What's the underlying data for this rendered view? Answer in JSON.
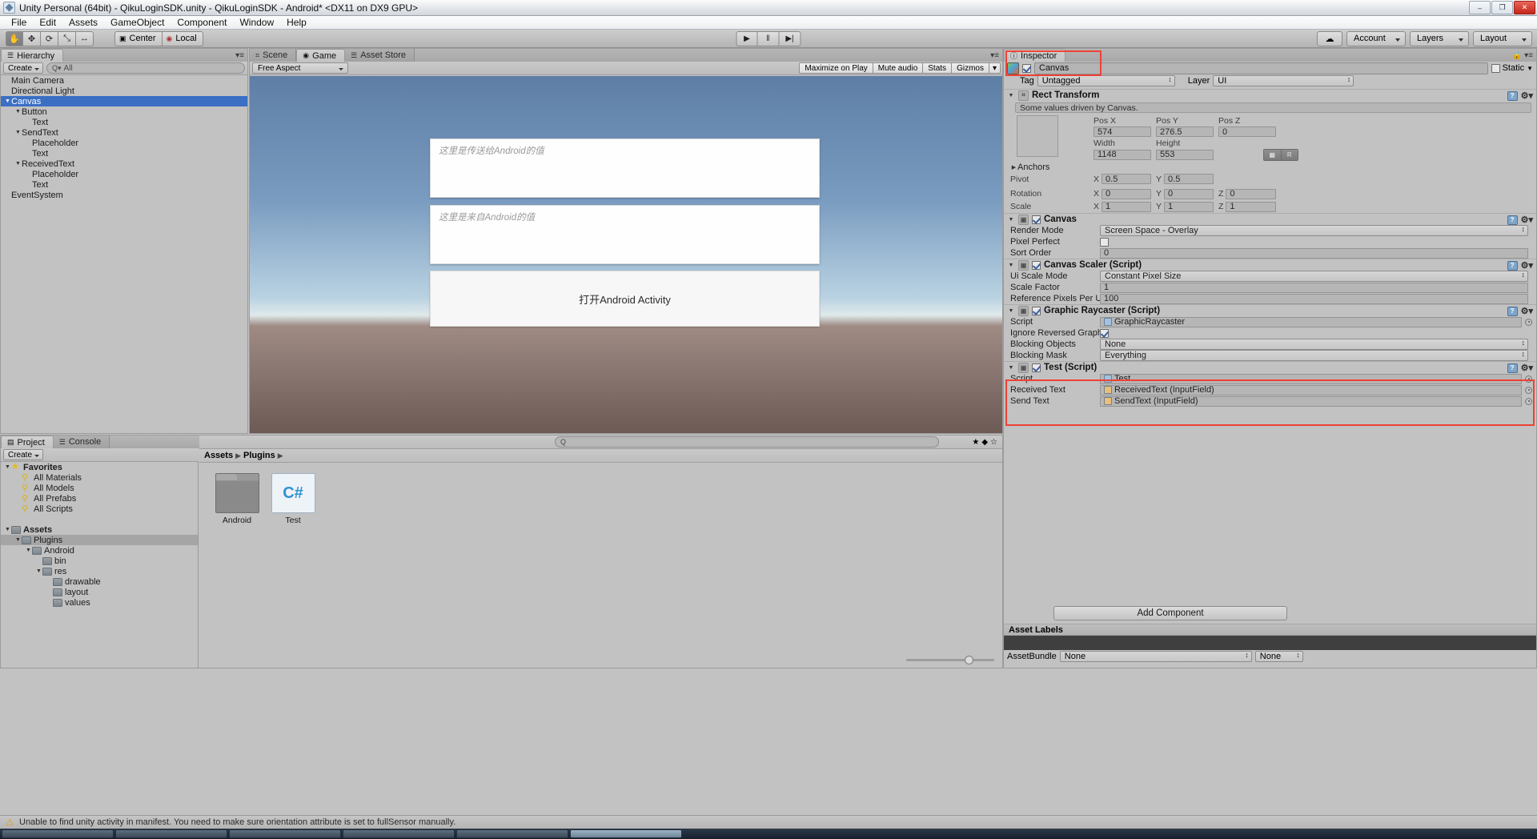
{
  "window": {
    "title": "Unity Personal (64bit) - QikuLoginSDK.unity - QikuLoginSDK - Android* <DX11 on DX9 GPU>",
    "minimize": "–",
    "maximize": "❐",
    "close": "✕"
  },
  "menu": [
    "File",
    "Edit",
    "Assets",
    "GameObject",
    "Component",
    "Window",
    "Help"
  ],
  "toolbar": {
    "tools": [
      "✋",
      "✥",
      "⟳",
      "⤡",
      "↔"
    ],
    "pivot": "Center",
    "space": "Local",
    "play": "▶",
    "pause": "‖",
    "step": "▶|",
    "cloud": "☁",
    "account": "Account",
    "layers": "Layers",
    "layout": "Layout"
  },
  "hierarchy": {
    "tab": "Hierarchy",
    "tab_icon": "hierarchy-icon",
    "create": "Create",
    "search_placeholder": "All",
    "items": [
      {
        "label": "Main Camera",
        "depth": 0,
        "arrow": "",
        "selected": false
      },
      {
        "label": "Directional Light",
        "depth": 0,
        "arrow": "",
        "selected": false
      },
      {
        "label": "Canvas",
        "depth": 0,
        "arrow": "▼",
        "selected": true
      },
      {
        "label": "Button",
        "depth": 1,
        "arrow": "▼",
        "selected": false
      },
      {
        "label": "Text",
        "depth": 2,
        "arrow": "",
        "selected": false
      },
      {
        "label": "SendText",
        "depth": 1,
        "arrow": "▼",
        "selected": false
      },
      {
        "label": "Placeholder",
        "depth": 2,
        "arrow": "",
        "selected": false
      },
      {
        "label": "Text",
        "depth": 2,
        "arrow": "",
        "selected": false
      },
      {
        "label": "ReceivedText",
        "depth": 1,
        "arrow": "▼",
        "selected": false
      },
      {
        "label": "Placeholder",
        "depth": 2,
        "arrow": "",
        "selected": false
      },
      {
        "label": "Text",
        "depth": 2,
        "arrow": "",
        "selected": false
      },
      {
        "label": "EventSystem",
        "depth": 0,
        "arrow": "",
        "selected": false
      }
    ]
  },
  "gamepanel": {
    "tabs": [
      {
        "label": "Scene",
        "active": false
      },
      {
        "label": "Game",
        "active": true
      },
      {
        "label": "Asset Store",
        "active": false
      }
    ],
    "aspect": "Free Aspect",
    "buttons": [
      "Maximize on Play",
      "Mute audio",
      "Stats",
      "Gizmos"
    ],
    "gizmos_arrow": "▾",
    "ui": {
      "send_placeholder": "这里是传送给Android的值",
      "received_placeholder": "这里是来自Android的值",
      "button_label": "打开Android Activity"
    }
  },
  "inspector": {
    "tab": "Inspector",
    "lock_icon": "lock-icon",
    "menu_icon": "panel-menu-icon",
    "object_name": "Canvas",
    "enabled": true,
    "static_label": "Static",
    "tag_label": "Tag",
    "tag_value": "Untagged",
    "layer_label": "Layer",
    "layer_value": "UI",
    "components": [
      {
        "name": "Rect Transform",
        "info": "Some values driven by Canvas.",
        "pos_labels": [
          "Pos X",
          "Pos Y",
          "Pos Z"
        ],
        "pos_values": [
          "574",
          "276.5",
          "0"
        ],
        "size_labels": [
          "Width",
          "Height"
        ],
        "size_values": [
          "1148",
          "553"
        ],
        "blueprint_btn": "▦",
        "raw_btn": "R",
        "anchors_label": "Anchors",
        "pivot_label": "Pivot",
        "pivot": {
          "x": "0.5",
          "y": "0.5"
        },
        "rotation_label": "Rotation",
        "rotation": {
          "x": "0",
          "y": "0",
          "z": "0"
        },
        "scale_label": "Scale",
        "scale": {
          "x": "1",
          "y": "1",
          "z": "1"
        }
      },
      {
        "name": "Canvas",
        "rows": [
          {
            "label": "Render Mode",
            "value": "Screen Space - Overlay",
            "type": "dropdown"
          },
          {
            "label": "Pixel Perfect",
            "value": "",
            "type": "checkbox",
            "checked": false
          },
          {
            "label": "Sort Order",
            "value": "0",
            "type": "field"
          }
        ]
      },
      {
        "name": "Canvas Scaler (Script)",
        "rows": [
          {
            "label": "Ui Scale Mode",
            "value": "Constant Pixel Size",
            "type": "dropdown"
          },
          {
            "label": "Scale Factor",
            "value": "1",
            "type": "field"
          },
          {
            "label": "Reference Pixels Per Ui",
            "value": "100",
            "type": "field"
          }
        ]
      },
      {
        "name": "Graphic Raycaster (Script)",
        "rows": [
          {
            "label": "Script",
            "value": "GraphicRaycaster",
            "type": "object"
          },
          {
            "label": "Ignore Reversed Graph",
            "value": "",
            "type": "checkbox",
            "checked": true
          },
          {
            "label": "Blocking Objects",
            "value": "None",
            "type": "dropdown"
          },
          {
            "label": "Blocking Mask",
            "value": "Everything",
            "type": "dropdown"
          }
        ]
      },
      {
        "name": "Test (Script)",
        "highlighted": true,
        "rows": [
          {
            "label": "Script",
            "value": "Test",
            "type": "object"
          },
          {
            "label": "Received Text",
            "value": "ReceivedText (InputField)",
            "type": "object"
          },
          {
            "label": "Send Text",
            "value": "SendText (InputField)",
            "type": "object"
          }
        ]
      }
    ],
    "add_component": "Add Component",
    "asset_labels_title": "Asset Labels",
    "assetbundle_label": "AssetBundle",
    "assetbundle_value": "None",
    "assetbundle_variant": "None"
  },
  "project": {
    "tabs": [
      {
        "label": "Project",
        "active": true
      },
      {
        "label": "Console",
        "active": false
      }
    ],
    "create": "Create",
    "search_placeholder": "",
    "breadcrumb": [
      "Assets",
      "Plugins"
    ],
    "tree": [
      {
        "label": "Favorites",
        "depth": 0,
        "arrow": "▼",
        "icon": "star",
        "bold": true,
        "selected": false
      },
      {
        "label": "All Materials",
        "depth": 1,
        "arrow": "",
        "icon": "search",
        "bold": false,
        "selected": false
      },
      {
        "label": "All Models",
        "depth": 1,
        "arrow": "",
        "icon": "search",
        "bold": false,
        "selected": false
      },
      {
        "label": "All Prefabs",
        "depth": 1,
        "arrow": "",
        "icon": "search",
        "bold": false,
        "selected": false
      },
      {
        "label": "All Scripts",
        "depth": 1,
        "arrow": "",
        "icon": "search",
        "bold": false,
        "selected": false
      },
      {
        "label": "",
        "depth": 0,
        "arrow": "",
        "icon": "",
        "bold": false,
        "selected": false
      },
      {
        "label": "Assets",
        "depth": 0,
        "arrow": "▼",
        "icon": "folder",
        "bold": true,
        "selected": false
      },
      {
        "label": "Plugins",
        "depth": 1,
        "arrow": "▼",
        "icon": "folder",
        "bold": false,
        "selected": true
      },
      {
        "label": "Android",
        "depth": 2,
        "arrow": "▼",
        "icon": "folder",
        "bold": false,
        "selected": false
      },
      {
        "label": "bin",
        "depth": 3,
        "arrow": "",
        "icon": "folder",
        "bold": false,
        "selected": false
      },
      {
        "label": "res",
        "depth": 3,
        "arrow": "▼",
        "icon": "folder",
        "bold": false,
        "selected": false
      },
      {
        "label": "drawable",
        "depth": 4,
        "arrow": "",
        "icon": "folder",
        "bold": false,
        "selected": false
      },
      {
        "label": "layout",
        "depth": 4,
        "arrow": "",
        "icon": "folder",
        "bold": false,
        "selected": false
      },
      {
        "label": "values",
        "depth": 4,
        "arrow": "",
        "icon": "folder",
        "bold": false,
        "selected": false
      }
    ],
    "assets": [
      {
        "name": "Android",
        "type": "folder"
      },
      {
        "name": "Test",
        "type": "cs",
        "glyph": "C#"
      }
    ],
    "toolbar_icons": [
      "favorites-icon",
      "label-icon",
      "star-icon"
    ]
  },
  "status": {
    "icon": "warning-icon",
    "message": "Unable to find unity activity in manifest. You need to make sure orientation attribute is set to fullSensor manually."
  }
}
